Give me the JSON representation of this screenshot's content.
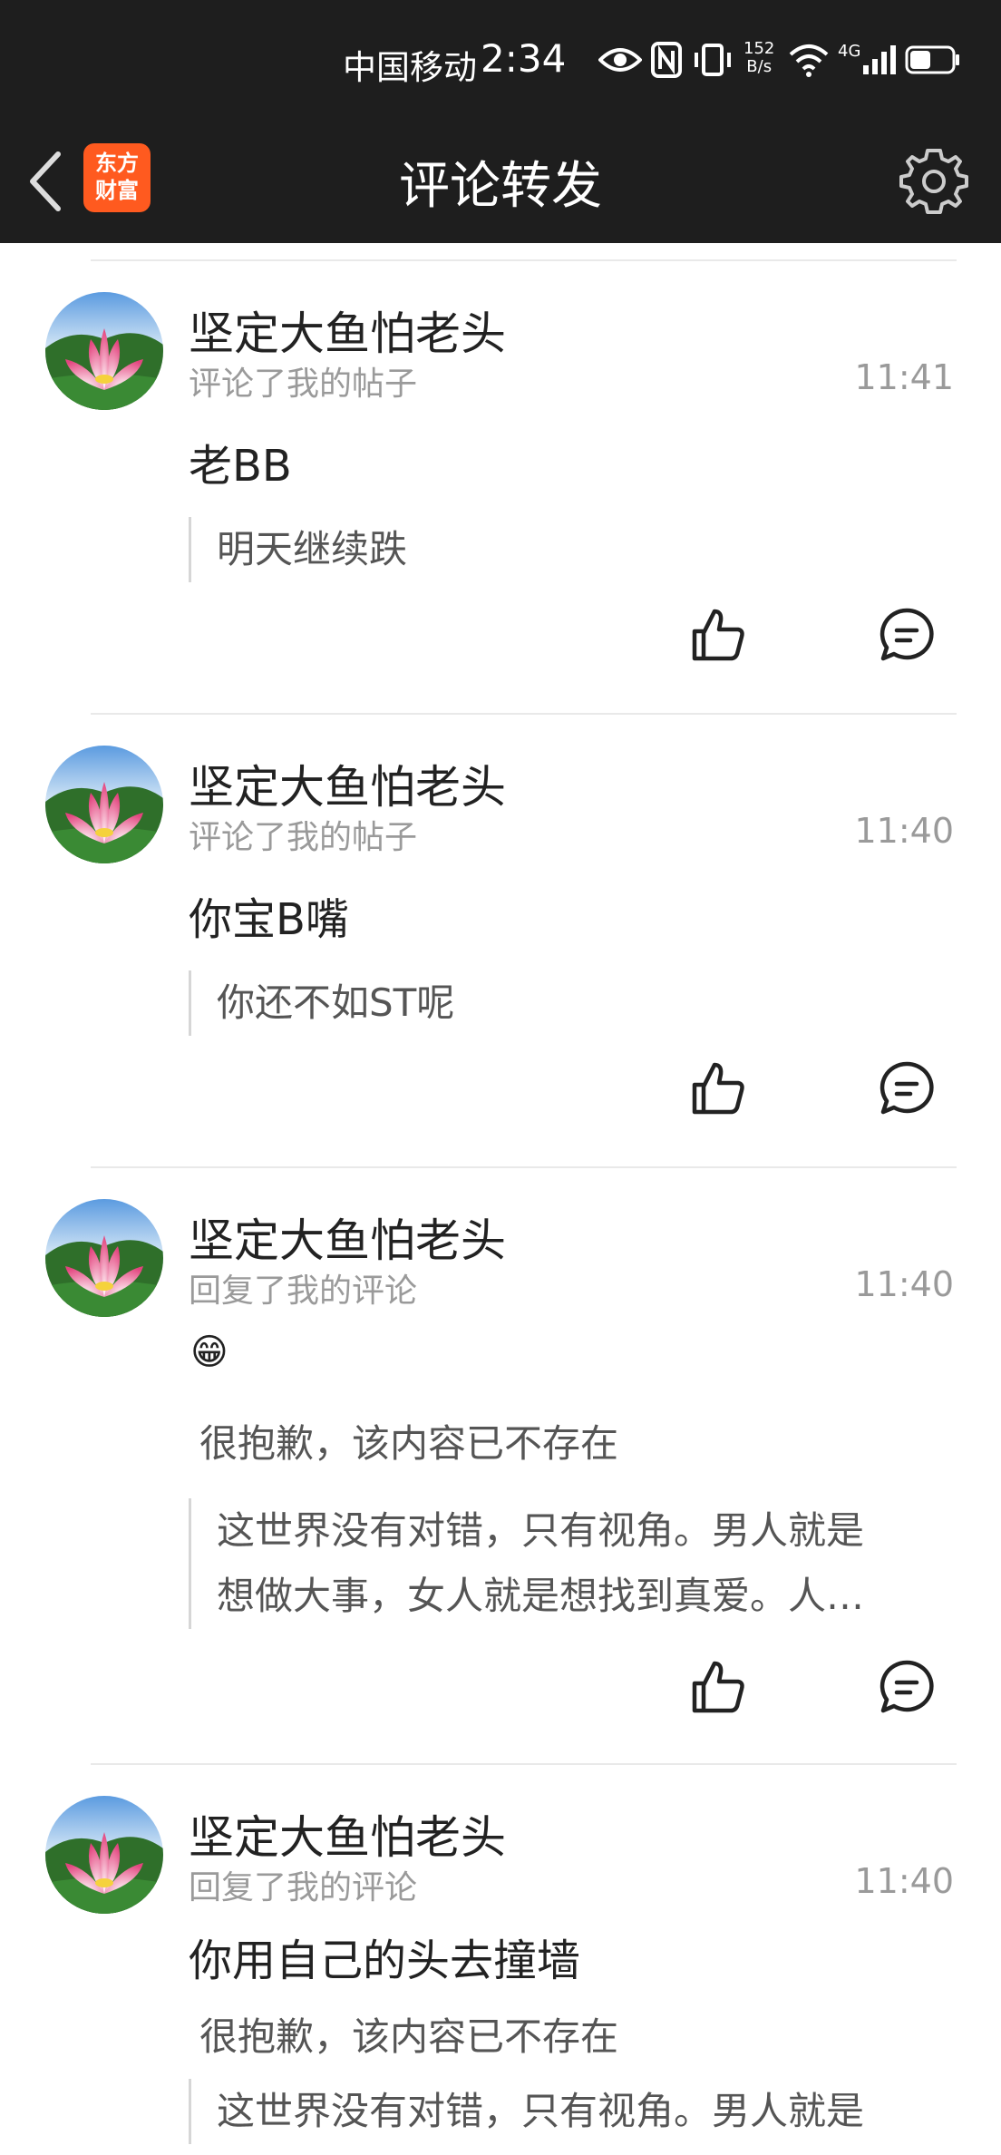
{
  "status_bar": {
    "carrier": "中国移动",
    "time": "2:34",
    "net_speed_value": "152",
    "net_speed_unit": "B/s",
    "network": "4G",
    "battery_level": 0.5
  },
  "nav": {
    "title": "评论转发",
    "logo_line1": "东方",
    "logo_line2": "财富"
  },
  "comments": [
    {
      "username": "坚定大鱼怕老头",
      "action": "评论了我的帖子",
      "time": "11:41",
      "content": "老BB",
      "quote": "明天继续跌"
    },
    {
      "username": "坚定大鱼怕老头",
      "action": "评论了我的帖子",
      "time": "11:40",
      "content": "你宝B嘴",
      "quote": "你还不如ST呢"
    },
    {
      "username": "坚定大鱼怕老头",
      "action": "回复了我的评论",
      "time": "11:40",
      "emoji": "😁",
      "notice": "很抱歉，该内容已不存在",
      "quote_line1": "这世界没有对错，只有视角。男人就是",
      "quote_line2": "想做大事，女人就是想找到真爱。人…"
    },
    {
      "username": "坚定大鱼怕老头",
      "action": "回复了我的评论",
      "time": "11:40",
      "content": "你用自己的头去撞墙",
      "notice": "很抱歉，该内容已不存在",
      "quote_line1": "这世界没有对错，只有视角。男人就是"
    }
  ]
}
